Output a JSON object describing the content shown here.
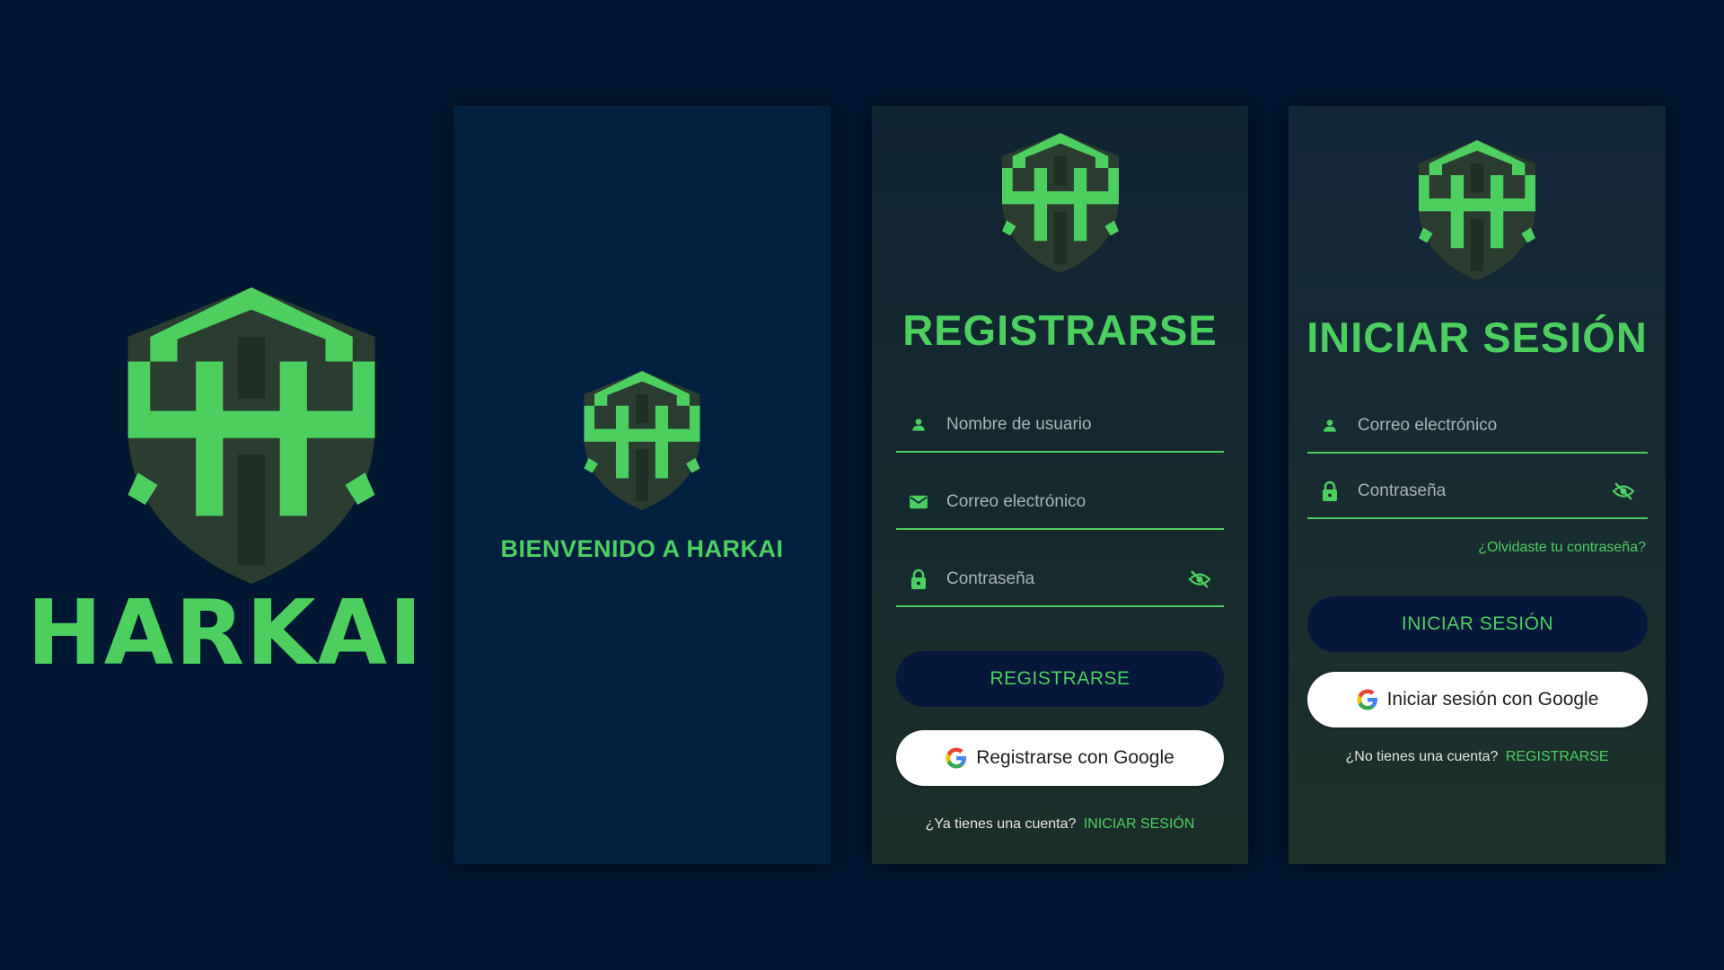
{
  "colors": {
    "background": "#021731",
    "accent": "#4ccf5f",
    "shield_dark": "#2b3d31",
    "button_dark": "#05173a",
    "google_button": "#ffffff"
  },
  "brand": {
    "name": "HARKAI",
    "logo_icon": "harkai-shield-logo"
  },
  "splash": {
    "welcome_text": "BIENVENIDO A HARKAI"
  },
  "register": {
    "title": "REGISTRARSE",
    "fields": {
      "username_placeholder": "Nombre de usuario",
      "email_placeholder": "Correo electrónico",
      "password_placeholder": "Contraseña"
    },
    "icons": {
      "username": "person-icon",
      "email": "mail-icon",
      "password": "lock-icon",
      "toggle": "eye-off-icon"
    },
    "submit_label": "REGISTRARSE",
    "google_label": "Registrarse con Google",
    "footer_text": "¿Ya tienes una cuenta?",
    "footer_link": "INICIAR SESIÓN"
  },
  "login": {
    "title": "INICIAR SESIÓN",
    "fields": {
      "email_placeholder": "Correo electrónico",
      "password_placeholder": "Contraseña"
    },
    "icons": {
      "email": "person-icon",
      "password": "lock-icon",
      "toggle": "eye-off-icon"
    },
    "forgot_link": "¿Olvidaste tu contraseña?",
    "submit_label": "INICIAR SESIÓN",
    "google_label": "Iniciar sesión con Google",
    "footer_text": "¿No tienes una cuenta?",
    "footer_link": "REGISTRARSE"
  }
}
